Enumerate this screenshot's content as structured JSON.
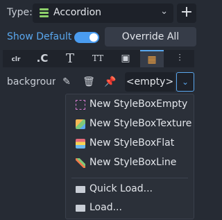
{
  "type_row": {
    "label": "Type:",
    "selected": "Accordion",
    "add_label": "+"
  },
  "default_row": {
    "show_default_label": "Show Default",
    "toggle_on": true,
    "override_label": "Override All"
  },
  "tabs": [
    {
      "name": "tab-colors",
      "glyph": "clr"
    },
    {
      "name": "tab-constants",
      "glyph": ".C"
    },
    {
      "name": "tab-fonts",
      "glyph": "T"
    },
    {
      "name": "tab-font-sizes",
      "glyph": "TT"
    },
    {
      "name": "tab-icons",
      "glyph": "▣"
    },
    {
      "name": "tab-styles",
      "glyph": "▦"
    },
    {
      "name": "tab-misc",
      "glyph": "⫶"
    }
  ],
  "property": {
    "label": "background",
    "value": "<empty>"
  },
  "menu": {
    "items": [
      {
        "label": "New StyleBoxEmpty",
        "icon": "stylebox-empty-icon"
      },
      {
        "label": "New StyleBoxTexture",
        "icon": "stylebox-texture-icon"
      },
      {
        "label": "New StyleBoxFlat",
        "icon": "stylebox-flat-icon"
      },
      {
        "label": "New StyleBoxLine",
        "icon": "stylebox-line-icon"
      },
      {
        "label": "Quick Load...",
        "icon": "folder-icon"
      },
      {
        "label": "Load...",
        "icon": "folder-icon"
      }
    ]
  },
  "colors": {
    "accent": "#5aa8ef",
    "background": "#262b34",
    "field": "#1d2129"
  }
}
